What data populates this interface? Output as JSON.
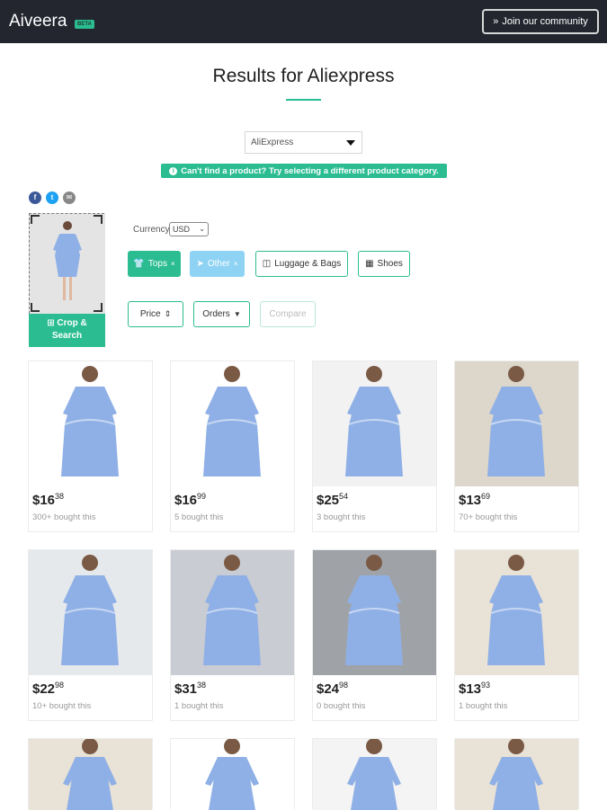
{
  "header": {
    "brand": "Aiveera",
    "badge": "BETA",
    "join_label": "Join our community"
  },
  "main": {
    "title": "Results for Aliexpress",
    "store_select": "AliExpress",
    "notice": "Can't find a product? Try selecting a different product category."
  },
  "social": [
    "facebook-icon",
    "twitter-icon",
    "email-icon"
  ],
  "crop": {
    "label_line1": "Crop &",
    "label_line2": "Search"
  },
  "currency": {
    "label": "Currency",
    "value": "USD"
  },
  "categories": [
    {
      "label": "Tops",
      "state": "active"
    },
    {
      "label": "Other",
      "state": "soft"
    },
    {
      "label": "Luggage & Bags",
      "state": "normal"
    },
    {
      "label": "Shoes",
      "state": "normal"
    }
  ],
  "controls": {
    "price": "Price",
    "orders": "Orders",
    "compare": "Compare"
  },
  "products": [
    {
      "whole": "$16",
      "cents": "38",
      "bought": "300+ bought this"
    },
    {
      "whole": "$16",
      "cents": "99",
      "bought": "5 bought this"
    },
    {
      "whole": "$25",
      "cents": "54",
      "bought": "3 bought this"
    },
    {
      "whole": "$13",
      "cents": "69",
      "bought": "70+ bought this"
    },
    {
      "whole": "$22",
      "cents": "98",
      "bought": "10+ bought this"
    },
    {
      "whole": "$31",
      "cents": "38",
      "bought": "1 bought this"
    },
    {
      "whole": "$24",
      "cents": "98",
      "bought": "0 bought this"
    },
    {
      "whole": "$13",
      "cents": "93",
      "bought": "1 bought this"
    }
  ],
  "colors": {
    "accent": "#2bbd91",
    "header_bg": "#23262f",
    "dress": "#8fb0e6",
    "soft_button": "#8fd3f4"
  }
}
